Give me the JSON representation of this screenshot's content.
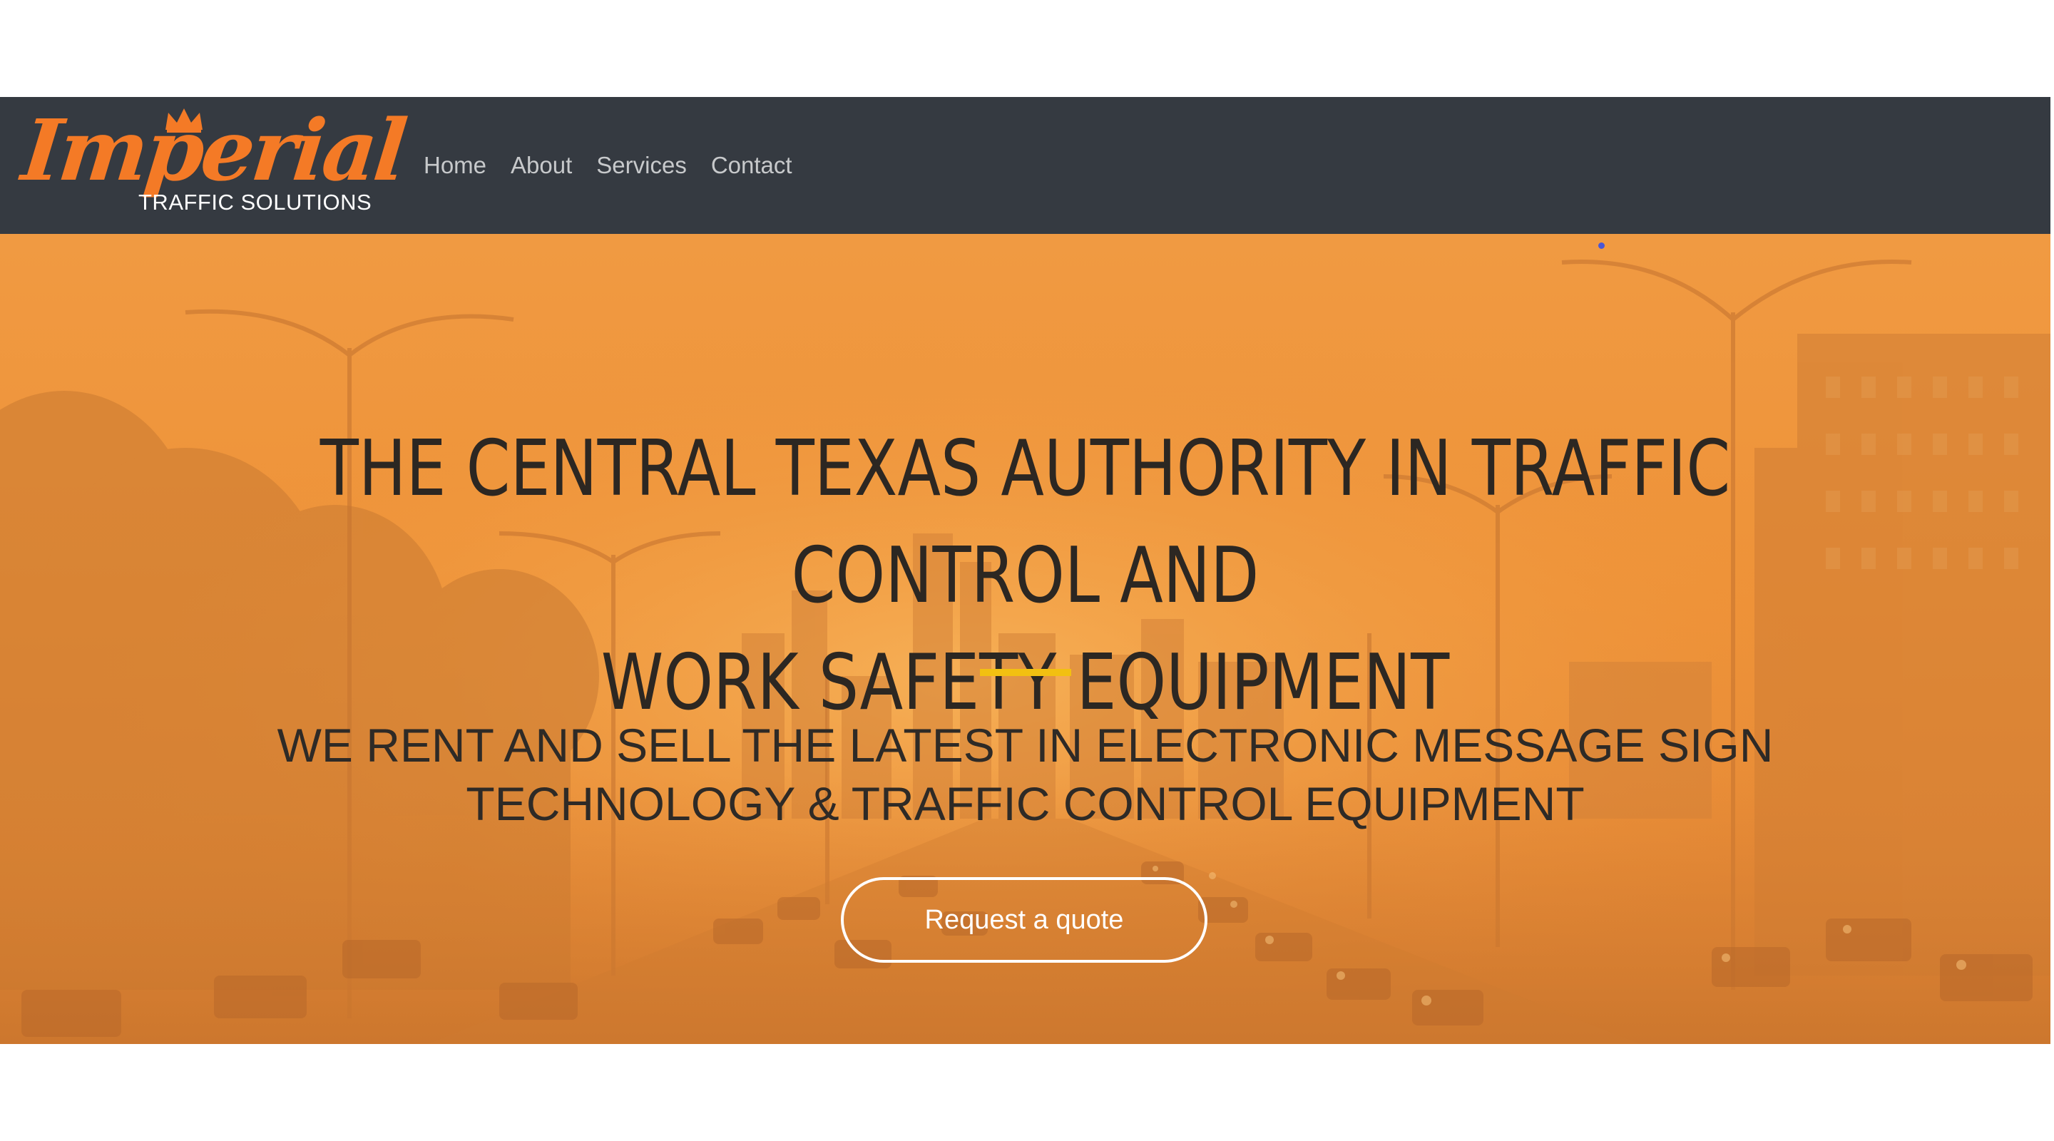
{
  "brand": {
    "logo_word": "Imperial",
    "logo_subtitle": "TRAFFIC SOLUTIONS",
    "accent_color": "#f47a26"
  },
  "nav": {
    "items": [
      {
        "label": "Home"
      },
      {
        "label": "About"
      },
      {
        "label": "Services"
      },
      {
        "label": "Contact"
      }
    ],
    "background_color": "#353a41"
  },
  "hero": {
    "title_line1": "THE CENTRAL TEXAS AUTHORITY IN TRAFFIC CONTROL AND",
    "title_line2": "WORK SAFETY EQUIPMENT",
    "subtitle_line1": "WE RENT AND SELL THE LATEST IN ELECTRONIC MESSAGE SIGN",
    "subtitle_line2": "TECHNOLOGY & TRAFFIC CONTROL EQUIPMENT",
    "cta_label": "Request a quote",
    "overlay_color": "#ee9238",
    "divider_color": "#f2c011",
    "background_image": "city-traffic-street-photo"
  }
}
